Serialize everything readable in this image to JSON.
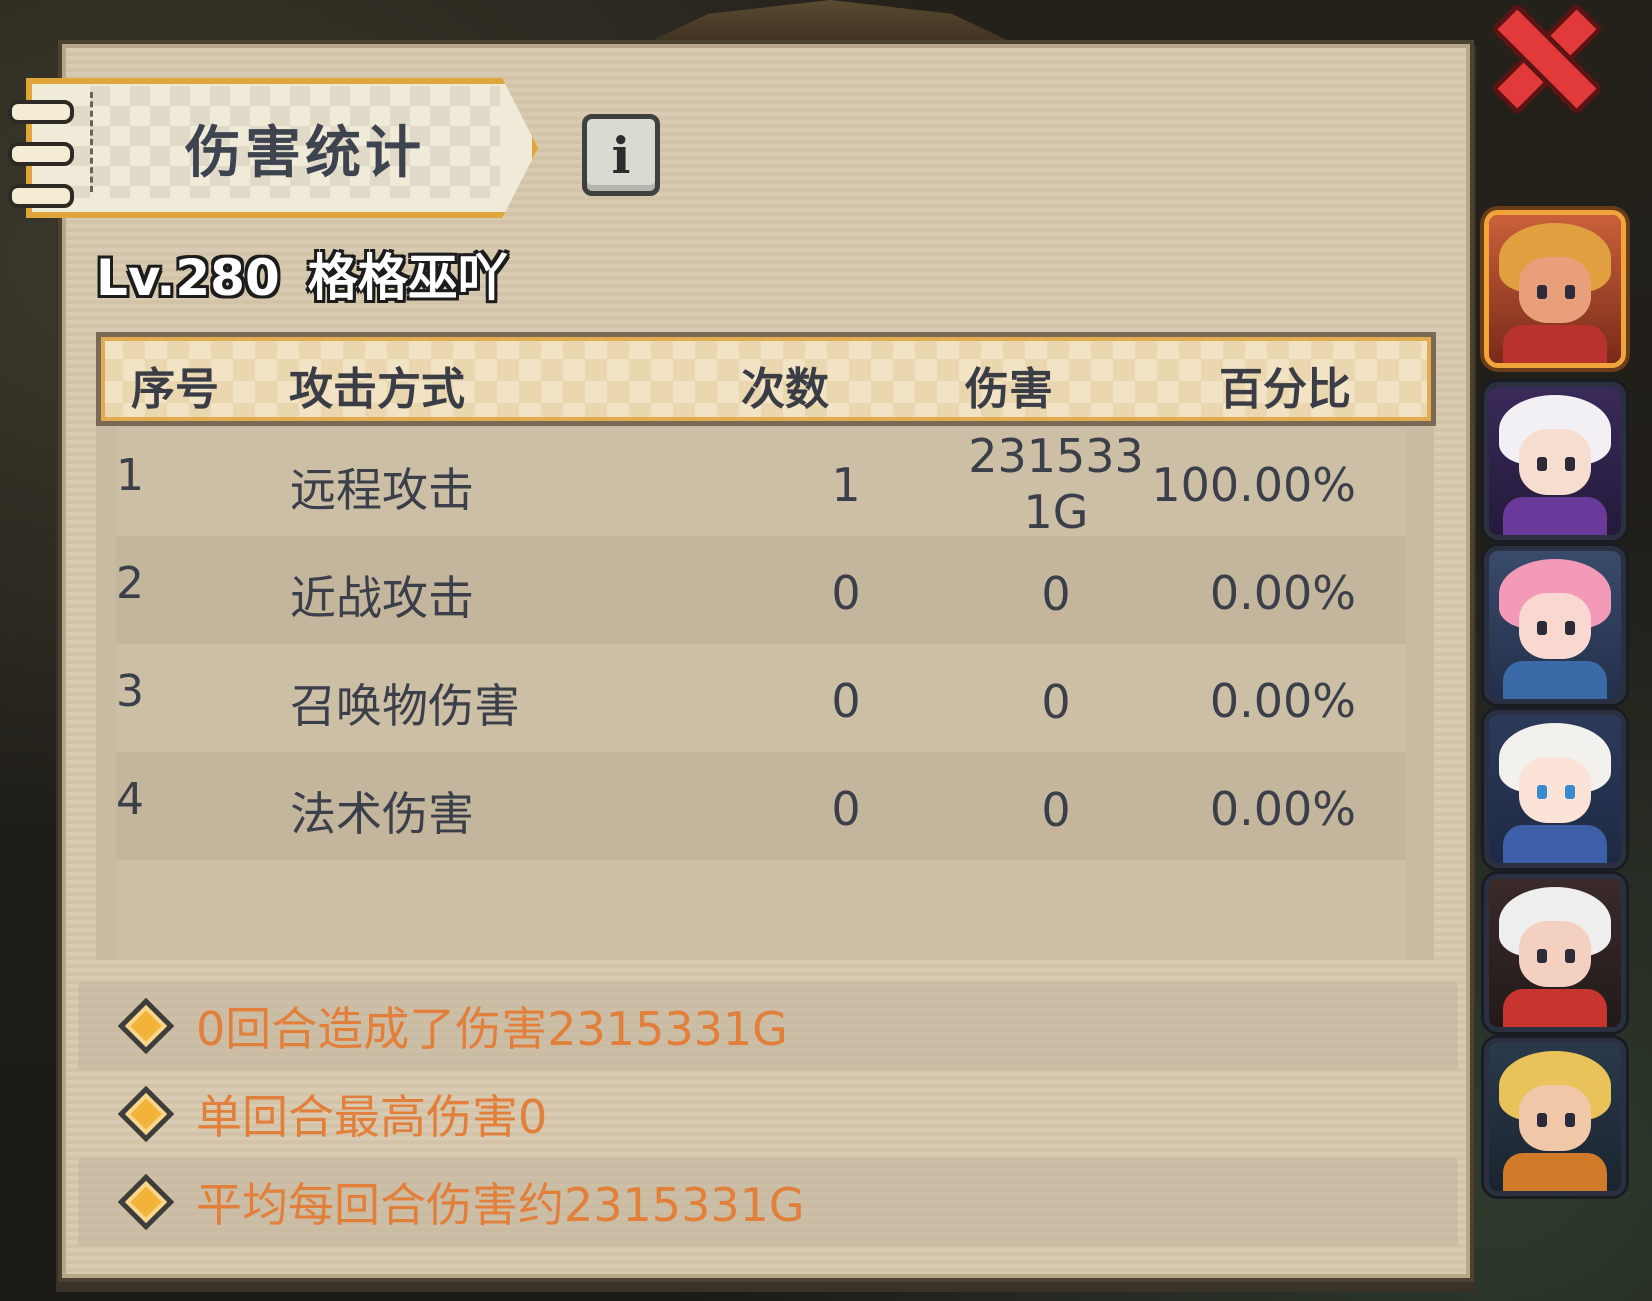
{
  "panel": {
    "title": "伤害统计",
    "info_glyph": "i"
  },
  "player": {
    "level": "Lv.280",
    "name": "格格巫吖"
  },
  "table": {
    "headers": [
      "序号",
      "攻击方式",
      "次数",
      "伤害",
      "百分比"
    ],
    "rows": [
      {
        "index": "1",
        "type": "远程攻击",
        "count": "1",
        "damage": "2315331G",
        "percent": "100.00%"
      },
      {
        "index": "2",
        "type": "近战攻击",
        "count": "0",
        "damage": "0",
        "percent": "0.00%"
      },
      {
        "index": "3",
        "type": "召唤物伤害",
        "count": "0",
        "damage": "0",
        "percent": "0.00%"
      },
      {
        "index": "4",
        "type": "法术伤害",
        "count": "0",
        "damage": "0",
        "percent": "0.00%"
      }
    ]
  },
  "summary": [
    "0回合造成了伤害2315331G",
    "单回合最高伤害0",
    "平均每回合伤害约2315331G"
  ],
  "heroes": [
    {
      "id": "hero-1",
      "selected": true,
      "hair": "#e0a040",
      "body": "#b8332e",
      "face": "#e9a07a"
    },
    {
      "id": "hero-2",
      "selected": false,
      "hair": "#f2f0f5",
      "body": "#6a3a9a",
      "face": "#f7dcd0"
    },
    {
      "id": "hero-3",
      "selected": false,
      "hair": "#f29ab8",
      "body": "#3a6aa8",
      "face": "#f8d8d0"
    },
    {
      "id": "hero-4",
      "selected": false,
      "hair": "#f3f1ee",
      "body": "#3c5fa8",
      "face": "#fbe3d8"
    },
    {
      "id": "hero-5",
      "selected": false,
      "hair": "#eeeeee",
      "body": "#c8352e",
      "face": "#f3d0c0"
    },
    {
      "id": "hero-6",
      "selected": false,
      "hair": "#e9c25a",
      "body": "#d07a2a",
      "face": "#f0c8a8"
    }
  ],
  "colors": {
    "accent_orange": "#e27f3a",
    "gold_border": "#e0a63a",
    "close_red": "#e23a3a"
  }
}
